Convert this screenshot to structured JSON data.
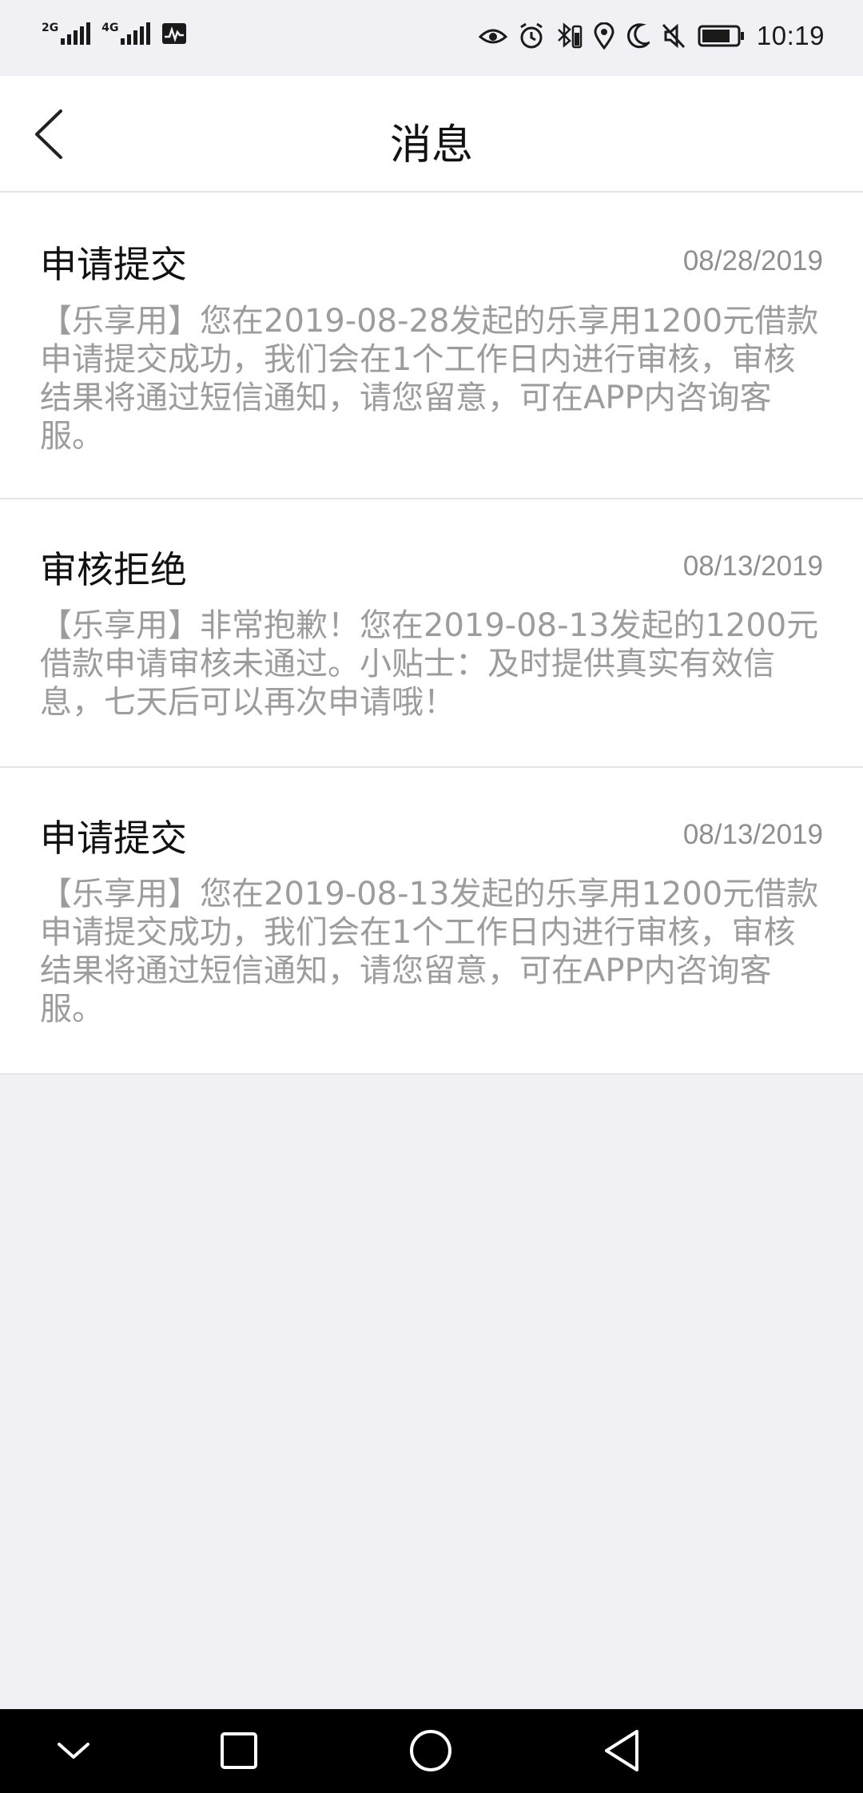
{
  "status_bar": {
    "network1": "2G",
    "network2": "4G",
    "time": "10:19",
    "icons": [
      "signal-icon",
      "activity-icon",
      "eye-icon",
      "alarm-icon",
      "bluetooth-icon",
      "location-icon",
      "moon-icon",
      "mute-icon",
      "battery-icon"
    ]
  },
  "header": {
    "title": "消息",
    "back_icon": "chevron-left-icon"
  },
  "messages": [
    {
      "title": "申请提交",
      "date": "08/28/2019",
      "body": "【乐享用】您在2019-08-28发起的乐享用1200元借款申请提交成功，我们会在1个工作日内进行审核，审核结果将通过短信通知，请您留意，可在APP内咨询客服。"
    },
    {
      "title": "审核拒绝",
      "date": "08/13/2019",
      "body": "【乐享用】非常抱歉！您在2019-08-13发起的1200元借款申请审核未通过。小贴士：及时提供真实有效信息，七天后可以再次申请哦！"
    },
    {
      "title": "申请提交",
      "date": "08/13/2019",
      "body": "【乐享用】您在2019-08-13发起的乐享用1200元借款申请提交成功，我们会在1个工作日内进行审核，审核结果将通过短信通知，请您留意，可在APP内咨询客服。"
    }
  ],
  "nav_bar": {
    "buttons": [
      "chevron-down-icon",
      "square-icon",
      "circle-icon",
      "triangle-back-icon"
    ]
  }
}
